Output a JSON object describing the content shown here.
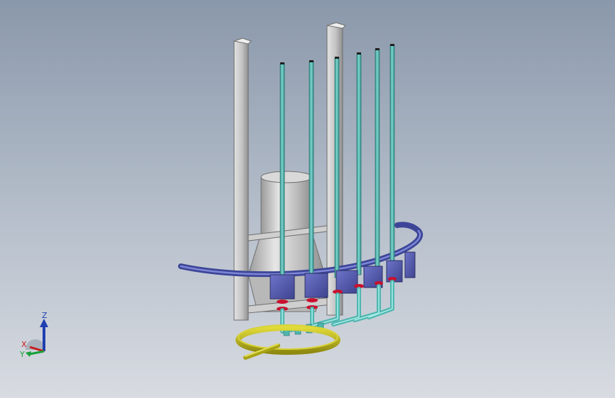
{
  "viewport": {
    "background_top": "#8a98ab",
    "background_bottom": "#d8dbe1"
  },
  "model": {
    "frame_color": "#c9c9c9",
    "tank_color": "#bdbdbd",
    "pipe_color": "#4fb6b0",
    "ring_pipe_color": "#4b56a8",
    "valve_color": "#5c62b8",
    "fitting_color": "#c8102e",
    "base_ring_color": "#c8c21a",
    "vertical_pipe_count": 6
  },
  "triad": {
    "z_label": "Z",
    "x_label": "X",
    "y_label": "Y",
    "z_color": "#1f3fb0",
    "x_color": "#c81a1a",
    "y_color": "#18a03a"
  }
}
